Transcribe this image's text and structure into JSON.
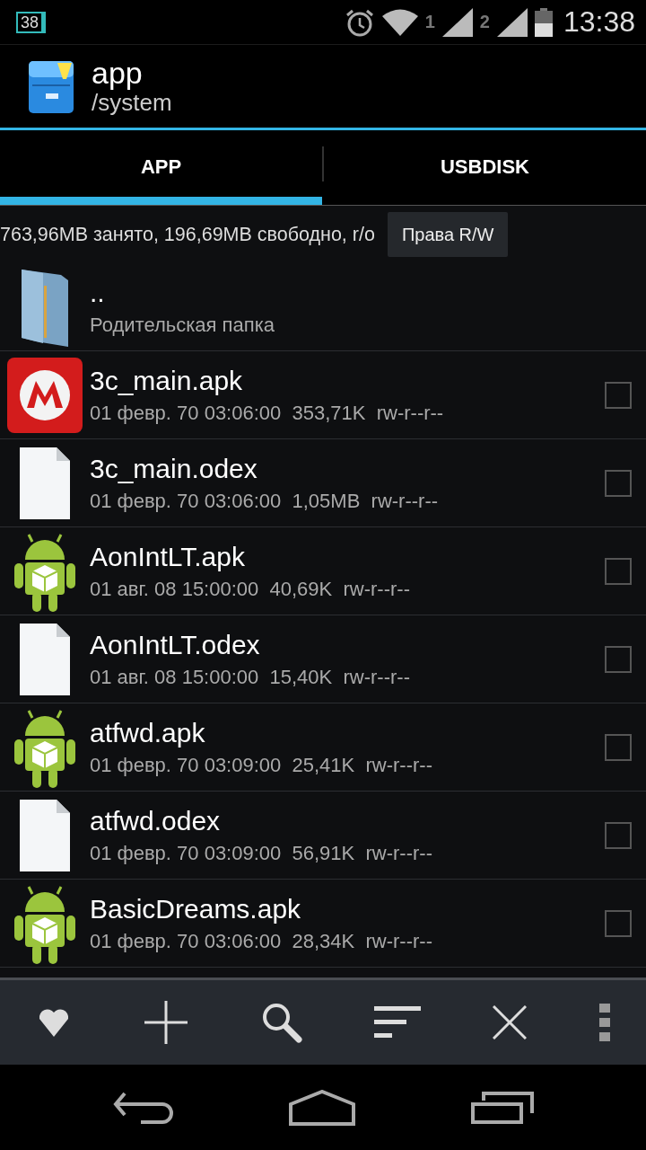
{
  "status_bar": {
    "battery_level_text": "38",
    "sim_1": "1",
    "sim_2": "2",
    "time": "13:38"
  },
  "header": {
    "title": "app",
    "path": "/system"
  },
  "tabs": [
    {
      "label": "APP",
      "selected": true
    },
    {
      "label": "USBDISK",
      "selected": false
    }
  ],
  "storage": {
    "info": "763,96MB занято, 196,69MB свободно, r/o",
    "button": "Права R/W"
  },
  "parent": {
    "name": "..",
    "description": "Родительская папка"
  },
  "files": [
    {
      "kind": "moto",
      "name": "3c_main.apk",
      "date": "01 февр. 70 03:06:00",
      "size": "353,71K",
      "perms": "rw-r--r--",
      "checked": false
    },
    {
      "kind": "doc",
      "name": "3c_main.odex",
      "date": "01 февр. 70 03:06:00",
      "size": "1,05MB",
      "perms": "rw-r--r--",
      "checked": false
    },
    {
      "kind": "android",
      "name": "AonIntLT.apk",
      "date": "01 авг. 08 15:00:00",
      "size": "40,69K",
      "perms": "rw-r--r--",
      "checked": false
    },
    {
      "kind": "doc",
      "name": "AonIntLT.odex",
      "date": "01 авг. 08 15:00:00",
      "size": "15,40K",
      "perms": "rw-r--r--",
      "checked": false
    },
    {
      "kind": "android",
      "name": "atfwd.apk",
      "date": "01 февр. 70 03:09:00",
      "size": "25,41K",
      "perms": "rw-r--r--",
      "checked": false
    },
    {
      "kind": "doc",
      "name": "atfwd.odex",
      "date": "01 февр. 70 03:09:00",
      "size": "56,91K",
      "perms": "rw-r--r--",
      "checked": false
    },
    {
      "kind": "android",
      "name": "BasicDreams.apk",
      "date": "01 февр. 70 03:06:00",
      "size": "28,34K",
      "perms": "rw-r--r--",
      "checked": false
    }
  ]
}
